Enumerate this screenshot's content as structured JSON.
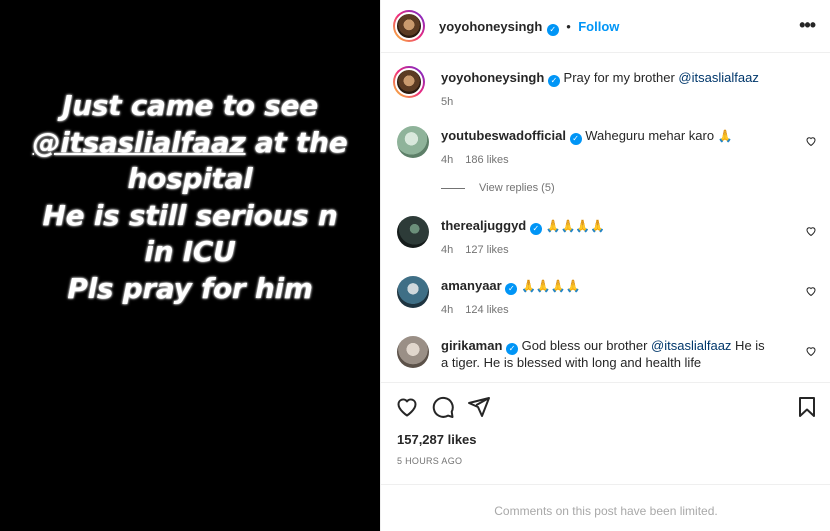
{
  "media": {
    "lines": [
      {
        "text": "Just came to see"
      },
      {
        "mention": "@itsaslialfaaz",
        "text": " at the"
      },
      {
        "text": "hospital"
      },
      {
        "text": "He is still serious n"
      },
      {
        "text": "in ICU"
      },
      {
        "text": "Pls pray for him"
      }
    ]
  },
  "header": {
    "username": "yoyohoneysingh",
    "verified_icon": "verified-badge-icon",
    "separator": "•",
    "follow_label": "Follow",
    "more_label": "•••"
  },
  "caption": {
    "username": "yoyohoneysingh",
    "text": "Pray for my brother ",
    "mention": "@itsaslialfaaz",
    "time": "5h"
  },
  "comments": [
    {
      "username": "youtubeswadofficial",
      "text": "Waheguru mehar karo ",
      "emoji": "🙏",
      "time": "4h",
      "likes": "186 likes",
      "avatar_color": "#8fb39a"
    },
    {
      "username": "therealjuggyd",
      "text": "",
      "emoji": "🙏🙏🙏🙏",
      "time": "4h",
      "likes": "127 likes",
      "avatar_color": "#2d3b38"
    },
    {
      "username": "amanyaar",
      "text": "",
      "emoji": "🙏🙏🙏🙏",
      "time": "4h",
      "likes": "124 likes",
      "avatar_color": "#3f6f86"
    },
    {
      "username": "girikaman",
      "text": "God bless our brother ",
      "mention": "@itsaslialfaaz",
      "text2": " He is a tiger. He is blessed with long and health life",
      "time": "",
      "likes": "",
      "avatar_color": "#9a8f86"
    }
  ],
  "view_replies": "View replies (5)",
  "actions": {
    "like_icon": "heart-icon",
    "comment_icon": "comment-icon",
    "share_icon": "share-icon",
    "save_icon": "bookmark-icon"
  },
  "likes_count": "157,287 likes",
  "post_time": "5 HOURS AGO",
  "comments_limited": "Comments on this post have been limited."
}
